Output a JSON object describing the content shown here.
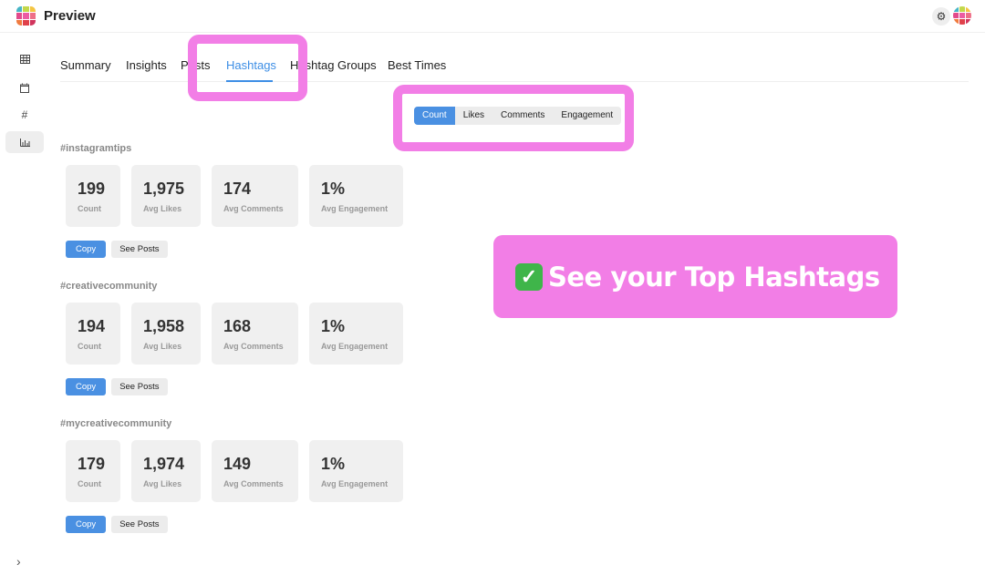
{
  "app": {
    "title": "Preview",
    "logo_colors": [
      "#46b5c6",
      "#c3d84a",
      "#f4c542",
      "#e24b8b",
      "#ec5ba3",
      "#ee6f88",
      "#f07b3f",
      "#e0414a",
      "#d1345d"
    ],
    "avatar_colors": [
      "#46b5c6",
      "#c3d84a",
      "#f4c542",
      "#e24b8b",
      "#ec5ba3",
      "#ee6f88",
      "#f07b3f",
      "#e0414a",
      "#d1345d"
    ]
  },
  "header": {
    "settings_icon": "gear-icon",
    "settings_glyph": "⚙"
  },
  "sidebar": {
    "items": [
      {
        "name": "grid",
        "icon": "grid-icon",
        "glyph": "▦"
      },
      {
        "name": "calendar",
        "icon": "calendar-icon",
        "glyph": "▭"
      },
      {
        "name": "hashtag",
        "icon": "hashtag-icon",
        "glyph": "#"
      },
      {
        "name": "analytics",
        "icon": "bar-chart-icon",
        "glyph": "lıl",
        "active": true
      }
    ],
    "expand_glyph": "›"
  },
  "tabs": [
    {
      "label": "Summary"
    },
    {
      "label": "Insights"
    },
    {
      "label": "Posts"
    },
    {
      "label": "Hashtags",
      "active": true
    },
    {
      "label": "Hashtag Groups"
    },
    {
      "label": "Best Times"
    }
  ],
  "sort_options": [
    {
      "label": "Count",
      "active": true
    },
    {
      "label": "Likes"
    },
    {
      "label": "Comments"
    },
    {
      "label": "Engagement"
    }
  ],
  "callout": {
    "check_glyph": "✓",
    "text": "See your Top Hashtags",
    "color": "#f27ee6"
  },
  "hashtags": [
    {
      "tag": "#instagramtips",
      "stats": [
        {
          "value": "199",
          "label": "Count"
        },
        {
          "value": "1,975",
          "label": "Avg Likes"
        },
        {
          "value": "174",
          "label": "Avg Comments"
        },
        {
          "value": "1%",
          "label": "Avg Engagement"
        }
      ]
    },
    {
      "tag": "#creativecommunity",
      "stats": [
        {
          "value": "194",
          "label": "Count"
        },
        {
          "value": "1,958",
          "label": "Avg Likes"
        },
        {
          "value": "168",
          "label": "Avg Comments"
        },
        {
          "value": "1%",
          "label": "Avg Engagement"
        }
      ]
    },
    {
      "tag": "#mycreativecommunity",
      "stats": [
        {
          "value": "179",
          "label": "Count"
        },
        {
          "value": "1,974",
          "label": "Avg Likes"
        },
        {
          "value": "149",
          "label": "Avg Comments"
        },
        {
          "value": "1%",
          "label": "Avg Engagement"
        }
      ]
    }
  ],
  "actions": {
    "copy_label": "Copy",
    "see_posts_label": "See Posts"
  },
  "colors": {
    "accent": "#4a90e2",
    "tab_active": "#3d8ee5",
    "highlight": "#f27ee6"
  }
}
